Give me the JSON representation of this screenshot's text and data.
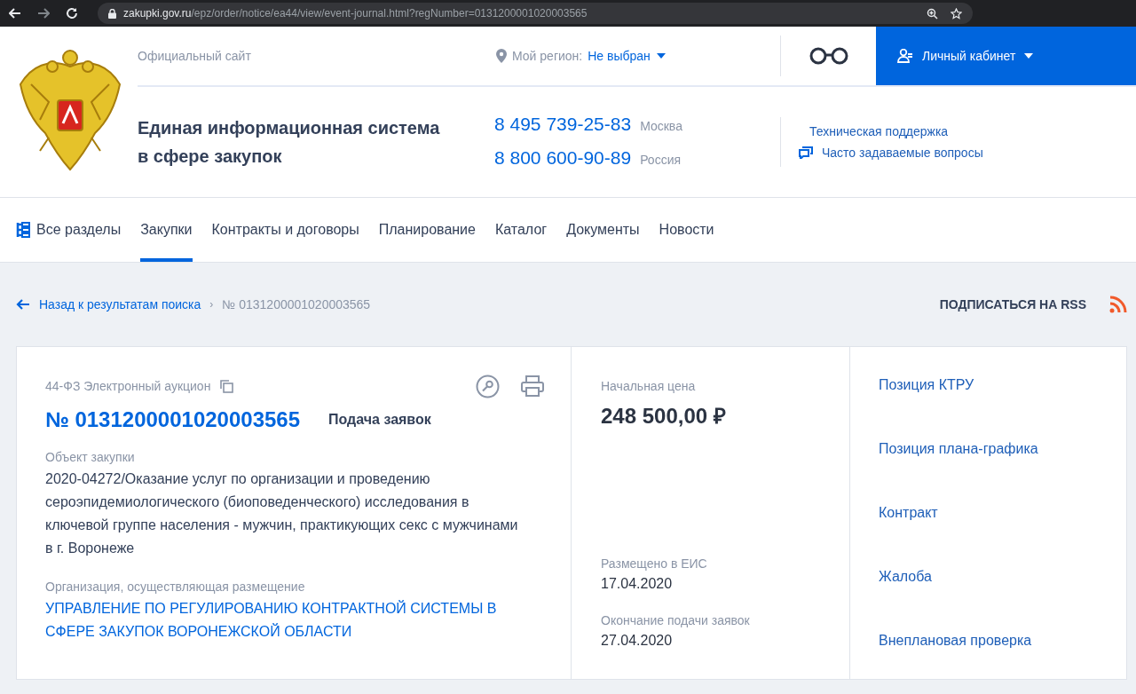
{
  "browser": {
    "url_host": "zakupki.gov.ru",
    "url_path": "/epz/order/notice/ea44/view/event-journal.html?regNumber=0131200001020003565"
  },
  "header": {
    "official": "Официальный сайт",
    "region_label": "Мой регион:",
    "region_value": "Не выбран",
    "cabinet": "Личный кабинет",
    "title_lines": [
      "Единая информационная система",
      "в сфере закупок"
    ],
    "phones": [
      {
        "number": "8 495 739-25-83",
        "city": "Москва"
      },
      {
        "number": "8 800 600-90-89",
        "city": "Россия"
      }
    ],
    "support": "Техническая поддержка",
    "faq": "Часто задаваемые вопросы"
  },
  "nav": [
    {
      "label": "Все разделы",
      "kind": "menu",
      "selected": false
    },
    {
      "label": "Закупки",
      "kind": "link",
      "selected": true
    },
    {
      "label": "Контракты и договоры",
      "kind": "link",
      "selected": false
    },
    {
      "label": "Планирование",
      "kind": "link",
      "selected": false
    },
    {
      "label": "Каталог",
      "kind": "link",
      "selected": false
    },
    {
      "label": "Документы",
      "kind": "link",
      "selected": false
    },
    {
      "label": "Новости",
      "kind": "link",
      "selected": false
    }
  ],
  "breadcrumbs": {
    "back": "Назад к результатам поиска",
    "separator": "›",
    "current": "№ 0131200001020003565"
  },
  "rss": "ПОДПИСАТЬСЯ НА RSS",
  "notice": {
    "type": "44-ФЗ Электронный аукцион",
    "number": "№ 0131200001020003565",
    "status": "Подача заявок",
    "object_label": "Объект закупки",
    "object": "2020-04272/Оказание услуг по организации и проведению сероэпидемиологического (биоповеденческого) исследования в ключевой группе населения - мужчин, практикующих секс с мужчинами в г. Воронеже",
    "org_label": "Организация, осуществляющая размещение",
    "org": "УПРАВЛЕНИЕ ПО РЕГУЛИРОВАНИЮ КОНТРАКТНОЙ СИСТЕМЫ В СФЕРЕ ЗАКУПОК ВОРОНЕЖСКОЙ ОБЛАСТИ",
    "price_label": "Начальная цена",
    "price": "248 500,00 ₽",
    "dates": [
      {
        "label": "Размещено в ЕИС",
        "value": "17.04.2020"
      },
      {
        "label": "Окончание подачи заявок",
        "value": "27.04.2020"
      }
    ],
    "links": [
      "Позиция КТРУ",
      "Позиция плана-графика",
      "Контракт",
      "Жалоба",
      "Внеплановая проверка"
    ]
  }
}
